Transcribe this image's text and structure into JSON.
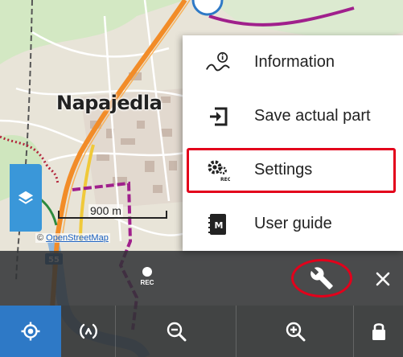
{
  "map": {
    "town_label": "Napajedla",
    "road_number": "55",
    "scale": {
      "label": "900 m"
    },
    "attribution": {
      "prefix": "© ",
      "link_text": "OpenStreetMap"
    }
  },
  "menu": {
    "items": [
      {
        "label": "Information",
        "icon": "info-route-icon"
      },
      {
        "label": "Save actual part",
        "icon": "save-map-icon"
      },
      {
        "label": "Settings",
        "icon": "settings-rec-icon",
        "highlighted": true
      },
      {
        "label": "User guide",
        "icon": "user-guide-icon"
      }
    ]
  },
  "panel": {
    "rec_label": "REC",
    "icons": [
      "record-icon",
      "wrench-icon",
      "close-icon"
    ]
  },
  "toolbar": {
    "icons": [
      "gps-locate-icon",
      "map-rotate-icon",
      "zoom-out-icon",
      "zoom-in-icon",
      "lock-icon"
    ]
  },
  "colors": {
    "accent_blue": "#2e79c6",
    "layers_blue": "#3a97d9",
    "highlight_red": "#e3001b",
    "panel_dark": "#303234",
    "route_purple": "#a0208c",
    "road_orange": "#f28c28"
  }
}
